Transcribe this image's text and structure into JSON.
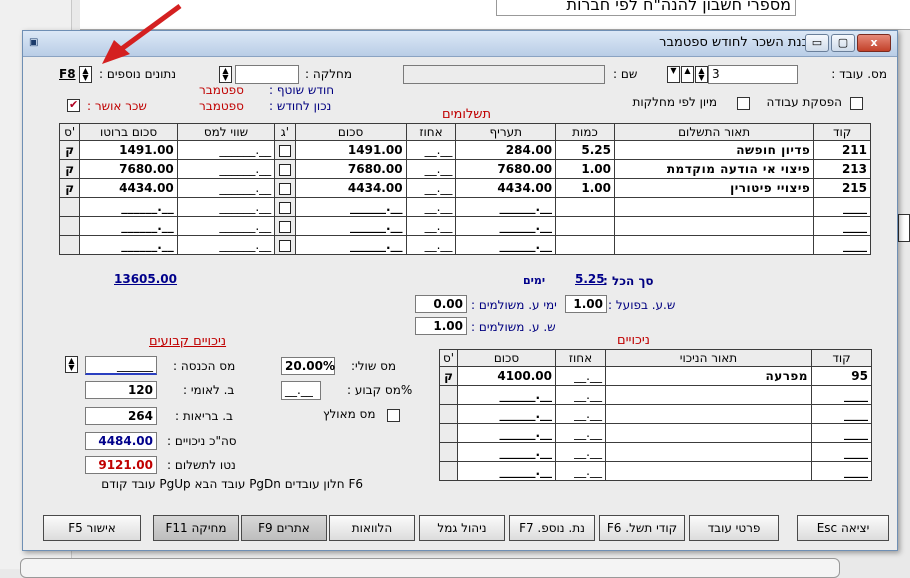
{
  "background": {
    "heading": "מספרי חשבון להנה\"ח לפי חברות"
  },
  "window": {
    "title": "הכנת השכר לחודש ספטמבר",
    "close_label": "x",
    "max_label": "▢",
    "min_label": "▭",
    "sys_icon": "window-icon"
  },
  "header": {
    "employee_no_label": "מס. עובד :",
    "employee_no_value": "3",
    "name_label": "שם :",
    "name_value": "",
    "department_label": "מחלקה :",
    "department_value": "",
    "extra_data_label": "נתונים נוספים :",
    "extra_data_key": "F8",
    "work_stop_label": "הפסקת עבודה",
    "sort_by_dept_label": "מיון לפי מחלקות",
    "approved_salary_label": "שכר אושר :",
    "approved_salary_checked": true,
    "current_month_label": "חודש שוטף :",
    "current_month_value": "ספטמבר",
    "correct_for_month_label": "נכון לחודש :",
    "correct_for_month_value": "ספטמבר"
  },
  "payments": {
    "title": "תשלומים",
    "columns": [
      "קוד",
      "תאור התשלום",
      "כמות",
      "תעריף",
      "אחוז",
      "סכום",
      "ג'",
      "שווי למס",
      "סכום ברוטו",
      "ס'"
    ],
    "rows": [
      {
        "code": "211",
        "desc": "פדיון חופשה",
        "qty": "5.25",
        "rate": "284.00",
        "pct": "__.__",
        "amount": "1491.00",
        "taxval": "______.__",
        "gross": "1491.00",
        "mark": "ק"
      },
      {
        "code": "213",
        "desc": "פיצוי אי הודעה מוקדמת",
        "qty": "1.00",
        "rate": "7680.00",
        "pct": "__.__",
        "amount": "7680.00",
        "taxval": "______.__",
        "gross": "7680.00",
        "mark": "ק"
      },
      {
        "code": "215",
        "desc": "פיצויי פיטורין",
        "qty": "1.00",
        "rate": "4434.00",
        "pct": "__.__",
        "amount": "4434.00",
        "taxval": "______.__",
        "gross": "4434.00",
        "mark": "ק"
      },
      {
        "code": "____",
        "desc": "",
        "qty": "",
        "rate": "______.__",
        "pct": "__.__",
        "amount": "______.__",
        "taxval": "______.__",
        "gross": "______.__",
        "mark": ""
      },
      {
        "code": "____",
        "desc": "",
        "qty": "",
        "rate": "______.__",
        "pct": "__.__",
        "amount": "______.__",
        "taxval": "______.__",
        "gross": "______.__",
        "mark": ""
      },
      {
        "code": "____",
        "desc": "",
        "qty": "",
        "rate": "______.__",
        "pct": "__.__",
        "amount": "______.__",
        "taxval": "______.__",
        "gross": "______.__",
        "mark": ""
      }
    ],
    "total_label": "סך הכל :",
    "total_qty": "5.25",
    "days_label": "ימים",
    "total_gross": "13605.00",
    "actual_hours_label": "ש.ע. בפועל :",
    "actual_hours_value": "1.00",
    "paid_days_label": "ימי ע. משולמים :",
    "paid_days_value": "0.00",
    "paid_hours_label": "ש. ע. משולמים :",
    "paid_hours_value": "1.00"
  },
  "fixed_deductions": {
    "title": "ניכויים קבועים",
    "income_tax_label": "מס הכנסה :",
    "income_tax_value": "______",
    "national_ins_label": "ב. לאומי :",
    "national_ins_value": "120",
    "health_ins_label": "ב. בריאות :",
    "health_ins_value": "264",
    "total_deductions_label": "סה\"כ ניכויים :",
    "total_deductions_value": "4484.00",
    "net_label": "נטו לתשלום :",
    "net_value": "9121.00",
    "marginal_tax_label": "מס שולי:",
    "marginal_tax_value": "20.00%",
    "fixed_tax_label": "%מס קבוע :",
    "fixed_tax_value": "__.__",
    "accum_tax_label": "מס מאולץ"
  },
  "deductions": {
    "title": "ניכויים",
    "columns": [
      "קוד",
      "תאור הניכוי",
      "אחוז",
      "סכום",
      "ס'"
    ],
    "rows": [
      {
        "code": "95",
        "desc": "מפרעה",
        "pct": "__.__",
        "amount": "4100.00",
        "mark": "ק"
      },
      {
        "code": "____",
        "desc": "",
        "pct": "__.__",
        "amount": "______.__",
        "mark": ""
      },
      {
        "code": "____",
        "desc": "",
        "pct": "__.__",
        "amount": "______.__",
        "mark": ""
      },
      {
        "code": "____",
        "desc": "",
        "pct": "__.__",
        "amount": "______.__",
        "mark": ""
      },
      {
        "code": "____",
        "desc": "",
        "pct": "__.__",
        "amount": "______.__",
        "mark": ""
      },
      {
        "code": "____",
        "desc": "",
        "pct": "__.__",
        "amount": "______.__",
        "mark": ""
      }
    ]
  },
  "hint": "F6 חלון עובדים  PgDn עובד הבא  PgUp עובד קודם",
  "buttons": {
    "exit": "יציאה Esc",
    "employee_details": "פרטי עובד",
    "pay_codes": "קודי תשל. F6",
    "extra_data": "נת. נוספ. F7",
    "provident": "ניהול גמל",
    "loans": "הלוואות",
    "alerts": "אתרים F9",
    "delete": "מחיקה F11",
    "approve": "אישור F5"
  }
}
